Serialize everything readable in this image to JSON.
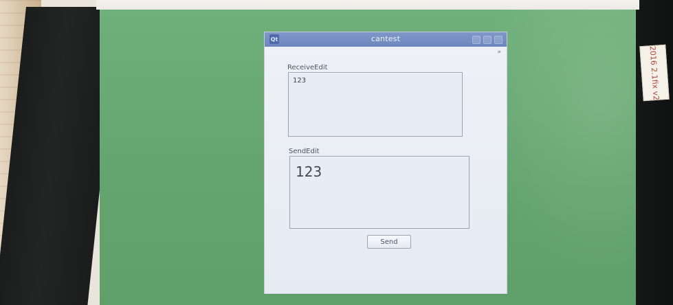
{
  "window": {
    "title": "cantest",
    "logo_text": "Qt",
    "corner_mark": "»"
  },
  "receive": {
    "label": "ReceiveEdit",
    "value": "123"
  },
  "send": {
    "label": "SendEdit",
    "value": "123",
    "button_label": "Send"
  },
  "sticker": {
    "text": "2016 2.1fix v2"
  }
}
